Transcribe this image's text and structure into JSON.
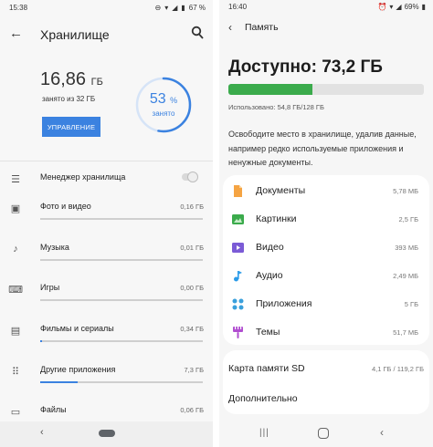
{
  "left": {
    "status": {
      "time": "15:38",
      "battery": "67 %"
    },
    "appbar": {
      "title": "Хранилище"
    },
    "summary": {
      "used_value": "16,86",
      "used_unit": "ГБ",
      "of_total": "занято из 32 ГБ",
      "manage_button": "УПРАВЛЕНИЕ",
      "percent_value": "53",
      "percent_sign": "%",
      "percent_label": "занято",
      "percent_fraction": 0.53
    },
    "manager": {
      "label": "Менеджер хранилища"
    },
    "categories": [
      {
        "label": "Фото и видео",
        "size": "0,16 ГБ",
        "fill": 0.0
      },
      {
        "label": "Музыка",
        "size": "0,01 ГБ",
        "fill": 0.0
      },
      {
        "label": "Игры",
        "size": "0,00 ГБ",
        "fill": 0.0
      },
      {
        "label": "Фильмы и сериалы",
        "size": "0,34 ГБ",
        "fill": 0.01
      },
      {
        "label": "Другие приложения",
        "size": "7,3 ГБ",
        "fill": 0.23
      },
      {
        "label": "Файлы",
        "size": "0,06 ГБ",
        "fill": 0.0
      }
    ],
    "accent": "#3b82e0"
  },
  "right": {
    "status": {
      "time": "16:40",
      "battery": "69%"
    },
    "appbar": {
      "title": "Память"
    },
    "free_label": "Доступно: 73,2 ГБ",
    "used_text": "Использовано: 54,8 ГБ/128 ГБ",
    "used_fraction": 0.43,
    "description": "Освободите место в хранилище, удалив данные, например редко используемые приложения и ненужные документы.",
    "items": [
      {
        "label": "Документы",
        "size": "5,78 МБ",
        "icon": "document-icon",
        "color": "#f5a443"
      },
      {
        "label": "Картинки",
        "size": "2,5 ГБ",
        "icon": "image-icon",
        "color": "#3bab4c"
      },
      {
        "label": "Видео",
        "size": "393 МБ",
        "icon": "video-icon",
        "color": "#7b5bd6"
      },
      {
        "label": "Аудио",
        "size": "2,49 МБ",
        "icon": "audio-icon",
        "color": "#2b9be8"
      },
      {
        "label": "Приложения",
        "size": "5 ГБ",
        "icon": "apps-icon",
        "color": "#3aa0dc"
      },
      {
        "label": "Темы",
        "size": "51,7 МБ",
        "icon": "themes-icon",
        "color": "#b14ed0"
      }
    ],
    "sd_card": {
      "label": "Карта памяти SD",
      "size": "4,1 ГБ / 119,2 ГБ"
    },
    "more": "Дополнительно",
    "accent": "#3bab4c"
  }
}
